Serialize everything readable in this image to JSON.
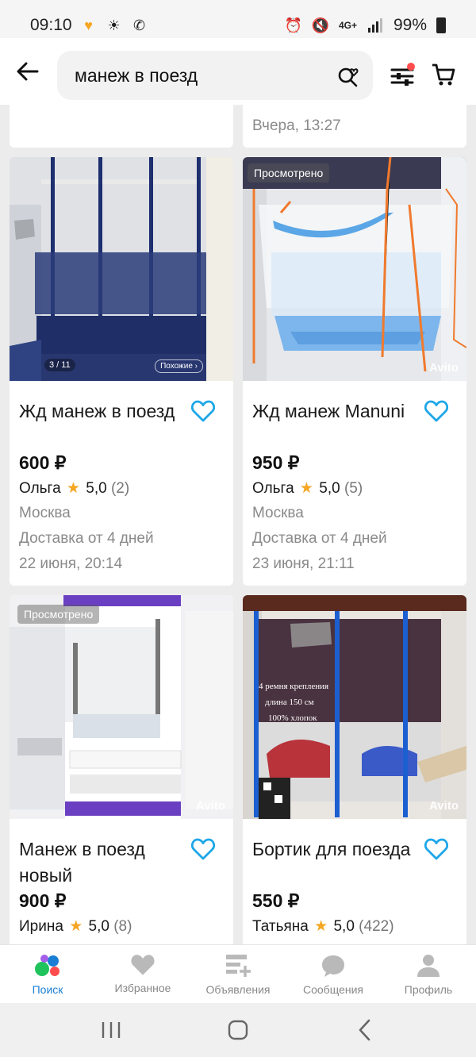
{
  "status_bar": {
    "time": "09:10",
    "network": "4G+",
    "battery": "99%"
  },
  "search": {
    "query": "манеж в поезд"
  },
  "top_partial": {
    "right_date": "Вчера, 13:27"
  },
  "cards": [
    {
      "title": "Жд манеж в поезд",
      "price": "600 ₽",
      "seller": "Ольга",
      "rating": "5,0",
      "reviews": "(2)",
      "city": "Москва",
      "delivery": "Доставка от 4 дней",
      "date": "22 июня, 20:14",
      "photo_counter": "3 / 11",
      "similar": "Похожие ›"
    },
    {
      "title": "Жд манеж Manuni",
      "price": "950 ₽",
      "seller": "Ольга",
      "rating": "5,0",
      "reviews": "(5)",
      "city": "Москва",
      "delivery": "Доставка от 4 дней",
      "date": "23 июня, 21:11",
      "badge": "Просмотрено",
      "watermark": "Avito"
    },
    {
      "title": "Манеж в поезд новый",
      "price": "900 ₽",
      "seller": "Ирина",
      "rating": "5,0",
      "reviews": "(8)",
      "badge": "Просмотрено",
      "watermark": "Avito"
    },
    {
      "title": "Бортик для поезда",
      "price": "550 ₽",
      "seller": "Татьяна",
      "rating": "5,0",
      "reviews": "(422)",
      "watermark": "Avito",
      "img_text_1": "4 ремня крепления",
      "img_text_2": "длина 150 см",
      "img_text_3": "100% хлопок"
    }
  ],
  "bottom_nav": [
    {
      "label": "Поиск",
      "icon": "search-dots-icon",
      "active": true
    },
    {
      "label": "Избранное",
      "icon": "heart-icon"
    },
    {
      "label": "Объявления",
      "icon": "listing-icon"
    },
    {
      "label": "Сообщения",
      "icon": "chat-icon"
    },
    {
      "label": "Профиль",
      "icon": "profile-icon"
    }
  ],
  "colors": {
    "accent": "#1a7fd4",
    "heart": "#1ea7e8",
    "star": "#f5a623",
    "notification_dot": "#ff4d4d"
  }
}
